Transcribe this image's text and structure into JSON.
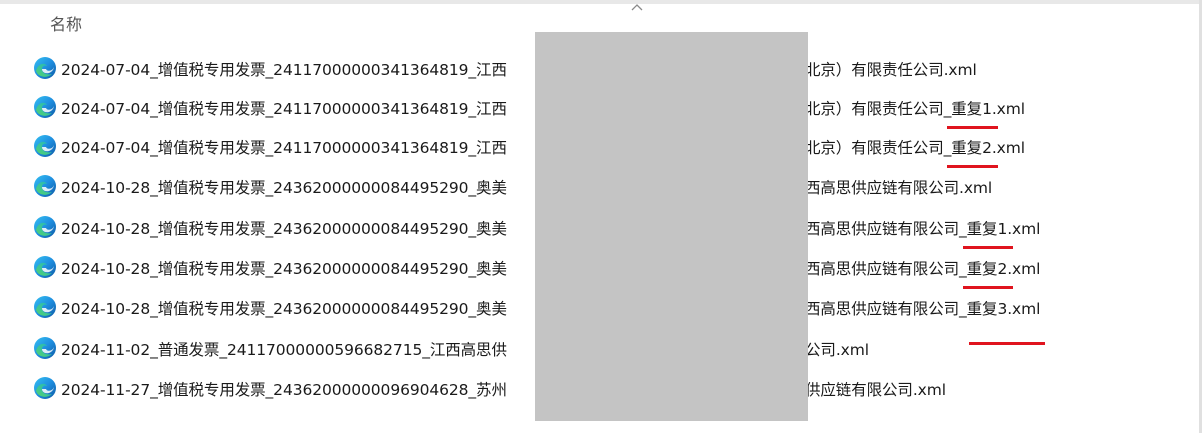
{
  "header": {
    "column_name": "名称",
    "sort_icon": "chevron-up-icon"
  },
  "file_icon": "edge-icon",
  "accent_color": "#e0141e",
  "files": [
    {
      "left": "2024-07-04_增值税专用发票_24117000000341364819_江西",
      "right_pre": "北京）有限责任公司",
      "right_dup": "",
      "right_post": ".xml"
    },
    {
      "left": "2024-07-04_增值税专用发票_24117000000341364819_江西",
      "right_pre": "北京）有限责任公司_",
      "right_dup": "重复1",
      "right_post": ".xml"
    },
    {
      "left": "2024-07-04_增值税专用发票_24117000000341364819_江西",
      "right_pre": "北京）有限责任公司_",
      "right_dup": "重复2",
      "right_post": ".xml"
    },
    {
      "left": "2024-10-28_增值税专用发票_24362000000084495290_奥美",
      "right_pre": "西高思供应链有限公司",
      "right_dup": "",
      "right_post": ".xml"
    },
    {
      "left": "2024-10-28_增值税专用发票_24362000000084495290_奥美",
      "right_pre": "西高思供应链有限公司_",
      "right_dup": "重复1",
      "right_post": ".xml"
    },
    {
      "left": "2024-10-28_增值税专用发票_24362000000084495290_奥美",
      "right_pre": "西高思供应链有限公司_",
      "right_dup": "重复2",
      "right_post": ".xml"
    },
    {
      "left": "2024-10-28_增值税专用发票_24362000000084495290_奥美",
      "right_pre": "西高思供应链有限公司_",
      "right_dup": "重复3",
      "right_post": ".xml"
    },
    {
      "left": "2024-11-02_普通发票_24117000000596682715_江西高思供",
      "right_pre": "公司",
      "right_dup": "",
      "right_post": ".xml"
    },
    {
      "left": "2024-11-27_增值税专用发票_24362000000096904628_苏州",
      "right_pre": "供应链有限公司",
      "right_dup": "",
      "right_post": ".xml"
    }
  ]
}
